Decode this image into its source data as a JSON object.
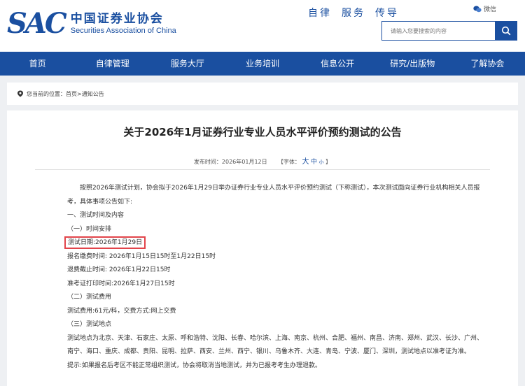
{
  "header": {
    "logo_mark": "SAC",
    "logo_cn": "中国证券业协会",
    "logo_en": "Securities Association of China",
    "motto": [
      "自律",
      "服务",
      "传导"
    ],
    "weibo_label": "微信",
    "search_placeholder": "请输入您要搜索的内容"
  },
  "nav": {
    "items": [
      "首页",
      "自律管理",
      "服务大厅",
      "业务培训",
      "信息公开",
      "研究/出版物",
      "了解协会"
    ]
  },
  "breadcrumb": {
    "label": "您当前的位置：",
    "home": "首页",
    "sep": ">",
    "current": "通知公告"
  },
  "article": {
    "title": "关于2026年1月证券行业专业人员水平评价预约测试的公告",
    "publish_label": "发布时间：",
    "publish_date": "2026年01月12日",
    "font_label": "【字体：",
    "font_big": "大",
    "font_mid": "中",
    "font_small": "小",
    "font_close": "】",
    "intro": "按照2026年测试计划，协会拟于2026年1月29日举办证券行业专业人员水平评价预约测试（下称测试），本次测试面向证券行业机构相关人员报考，具体事项公告如下:",
    "sec1": "一、测试时间及内容",
    "sec1_sub1": "（一）时间安排",
    "test_date": "测试日期:2026年1月29日",
    "reg_time": "报名缴费时间: 2026年1月15日15时至1月22日15时",
    "refund_deadline": "退费截止时间:  2026年1月22日15时",
    "ticket_time": "准考证打印时间:2026年1月27日15时",
    "sec1_sub2": "（二）测试费用",
    "fee": "测试费用:61元/科，交费方式:网上交费",
    "sec1_sub3": "（三）测试地点",
    "locations": "测试地点为北京、天津、石家庄、太原、呼和浩特、沈阳、长春、哈尔滨、上海、南京、杭州、合肥、福州、南昌、济南、郑州、武汉、长沙、广州、南宁、海口、重庆、成都、贵阳、昆明、拉萨、西安、兰州、西宁、银川、乌鲁木齐、大连、青岛、宁波、厦门、深圳，测试地点以准考证为准。",
    "tip": "提示:如果报名后考区不能正常组织测试，协会将取消当地测试，并为已报考考生办理退款。"
  },
  "colors": {
    "brand_blue": "#1a4fa0",
    "highlight_red": "#e2444a"
  }
}
